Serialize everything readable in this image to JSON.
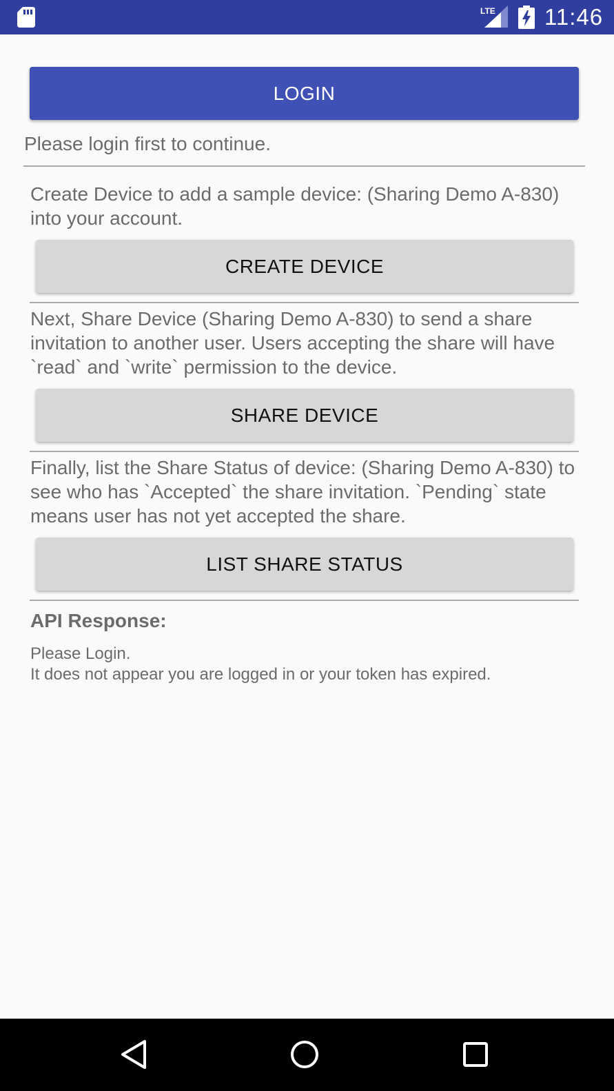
{
  "status_bar": {
    "network_label": "LTE",
    "time": "11:46",
    "background_color": "#303f9f",
    "icons": [
      "sd-card-icon",
      "lte-signal-icon",
      "battery-charging-icon"
    ]
  },
  "login": {
    "button_label": "LOGIN",
    "prompt": "Please login first to continue."
  },
  "steps": [
    {
      "description": "Create Device to add a sample device: (Sharing Demo A-830) into your account.",
      "button_label": "CREATE DEVICE"
    },
    {
      "description": "Next, Share Device (Sharing Demo A-830) to send a share invitation to another user.  Users accepting the share will have `read` and `write` permission to the device.",
      "button_label": "SHARE DEVICE"
    },
    {
      "description": "Finally, list the Share Status of device: (Sharing Demo A-830) to see who has `Accepted` the share invitation. `Pending` state means user has not yet accepted the share.",
      "button_label": "LIST SHARE STATUS"
    }
  ],
  "api_response": {
    "heading": "API Response:",
    "line1": "Please Login.",
    "line2": "It does not appear you are logged in or your token has expired."
  },
  "nav_bar": {
    "icons": [
      "back-icon",
      "home-icon",
      "recents-icon"
    ]
  },
  "colors": {
    "primary": "#3f51b5",
    "primary_dark": "#303f9f",
    "button_gray": "#d6d7d7",
    "text_gray": "#6b6b6b"
  }
}
